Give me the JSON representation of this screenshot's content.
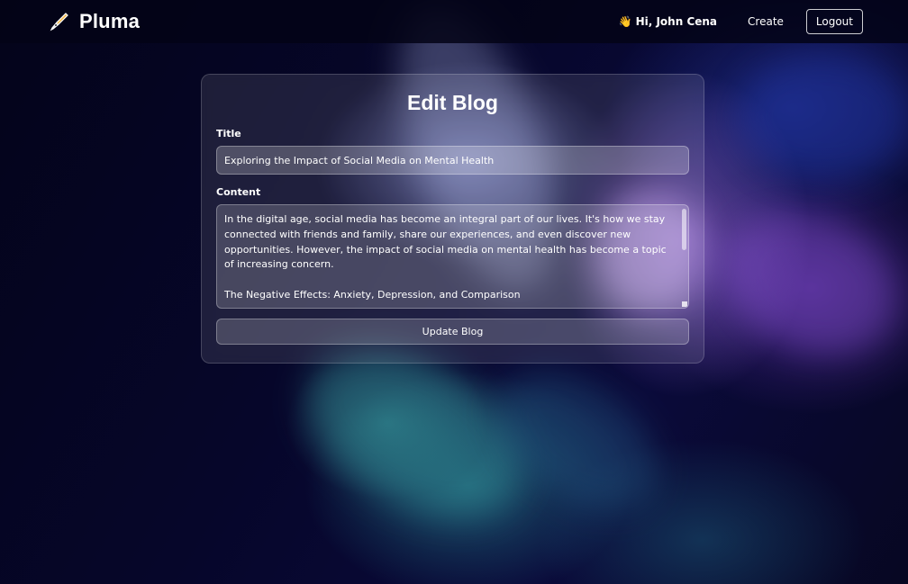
{
  "header": {
    "brand_name": "Pluma",
    "brand_icon": "fountain-pen-icon",
    "greeting_icon": "waving-hand-icon",
    "greeting": "Hi, John Cena",
    "create_label": "Create",
    "logout_label": "Logout"
  },
  "form": {
    "heading": "Edit Blog",
    "title_label": "Title",
    "title_value": "Exploring the Impact of Social Media on Mental Health",
    "content_label": "Content",
    "content_value": "In the digital age, social media has become an integral part of our lives. It's how we stay connected with friends and family, share our experiences, and even discover new opportunities. However, the impact of social media on mental health has become a topic of increasing concern.\n\nThe Negative Effects: Anxiety, Depression, and Comparison\n\nResearch has shown that excessive use of social media can contribute to anxiety, depression, and",
    "submit_label": "Update Blog"
  },
  "colors": {
    "background": "#05051a",
    "navbar": "#040416",
    "text": "#ffffff"
  }
}
